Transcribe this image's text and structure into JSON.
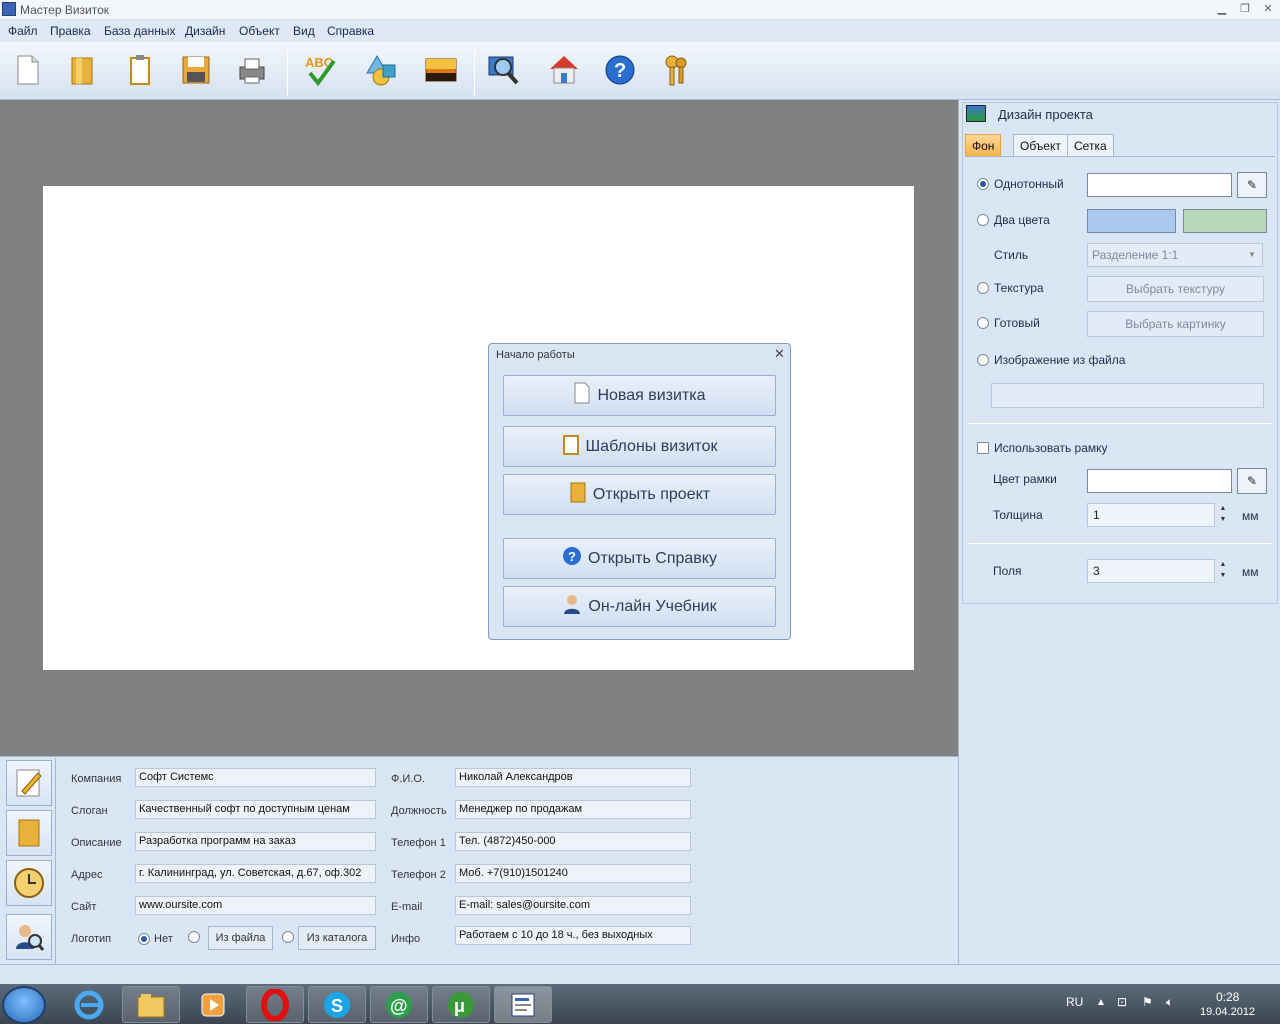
{
  "window": {
    "title": "Мастер Визиток"
  },
  "menu": [
    "Файл",
    "Правка",
    "База данных",
    "Дизайн",
    "Объект",
    "Вид",
    "Справка"
  ],
  "toolbar": {
    "icons": [
      "new-icon",
      "open-icon",
      "templates-icon",
      "save-icon",
      "print-icon",
      "spellcheck-icon",
      "shapes-icon",
      "image-icon",
      "zoom-icon",
      "home-icon",
      "help-icon",
      "keys-icon"
    ]
  },
  "dialog": {
    "title": "Начало работы",
    "buttons": [
      "Новая визитка",
      "Шаблоны визиток",
      "Открыть проект",
      "Открыть Справку",
      "Он-лайн Учебник"
    ]
  },
  "right_panel": {
    "title": "Дизайн проекта",
    "tabs": [
      "Фон",
      "Объект",
      "Сетка"
    ],
    "solid_label": "Однотонный",
    "two_colors_label": "Два цвета",
    "color1": "#a9c8ee",
    "color2": "#b9dab8",
    "style_label": "Стиль",
    "style_value": "Разделение 1:1",
    "texture_label": "Текстура",
    "texture_button": "Выбрать текстуру",
    "ready_label": "Готовый",
    "ready_button": "Выбрать картинку",
    "file_image_label": "Изображение из файла",
    "use_frame_label": "Использовать рамку",
    "frame_color_label": "Цвет рамки",
    "thickness_label": "Толщина",
    "thickness_value": "1",
    "margins_label": "Поля",
    "margins_value": "3",
    "unit": "мм"
  },
  "bottom_panel": {
    "left_fields": [
      {
        "label": "Компания",
        "value": "Софт Системс"
      },
      {
        "label": "Слоган",
        "value": "Качественный софт по доступным ценам"
      },
      {
        "label": "Описание",
        "value": "Разработка программ на заказ"
      },
      {
        "label": "Адрес",
        "value": "г. Калининград, ул. Советская, д.67, оф.302"
      },
      {
        "label": "Сайт",
        "value": "www.oursite.com"
      }
    ],
    "logo_label": "Логотип",
    "logo_none": "Нет",
    "logo_file": "Из файла",
    "logo_catalog": "Из каталога",
    "right_fields": [
      {
        "label": "Ф.И.О.",
        "value": "Николай Александров"
      },
      {
        "label": "Должность",
        "value": "Менеджер по продажам"
      },
      {
        "label": "Телефон 1",
        "value": "Тел. (4872)450-000"
      },
      {
        "label": "Телефон 2",
        "value": "Моб. +7(910)1501240"
      },
      {
        "label": "E-mail",
        "value": "E-mail: sales@oursite.com"
      },
      {
        "label": "Инфо",
        "value": "Работаем с 10 до 18 ч., без выходных"
      }
    ]
  },
  "taskbar": {
    "lang": "RU",
    "time": "0:28",
    "date": "19.04.2012"
  }
}
